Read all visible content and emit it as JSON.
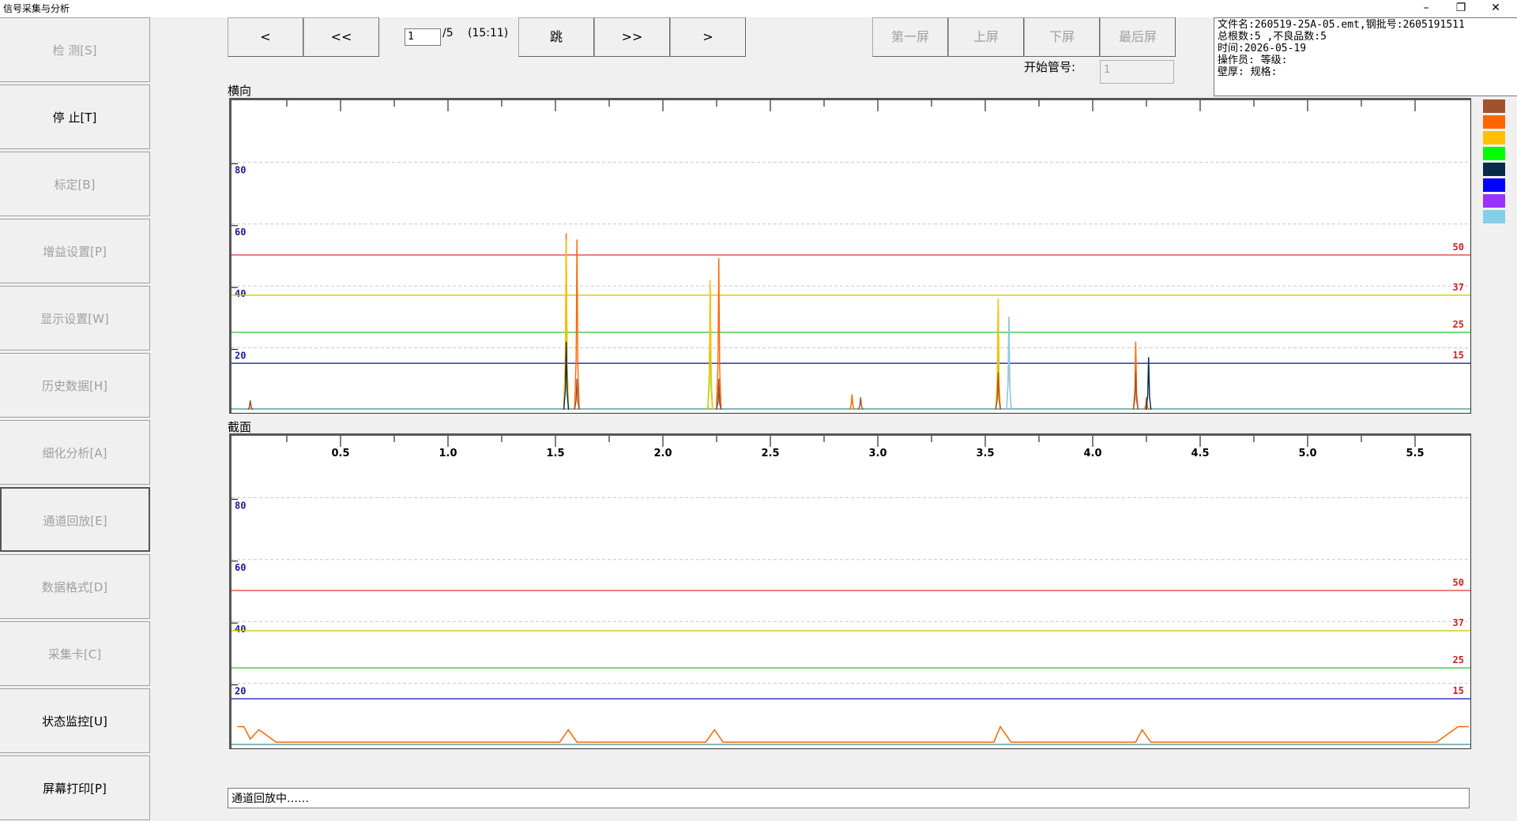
{
  "window": {
    "title": "信号采集与分析",
    "minimize": "–",
    "restore": "❐",
    "close": "✕"
  },
  "sidebar": {
    "items": [
      {
        "label": "检  测[S]",
        "enabled": false
      },
      {
        "label": "停 止[T]",
        "enabled": true
      },
      {
        "label": "标定[B]",
        "enabled": false
      },
      {
        "label": "增益设置[P]",
        "enabled": false
      },
      {
        "label": "显示设置[W]",
        "enabled": false
      },
      {
        "label": "历史数据[H]",
        "enabled": false
      },
      {
        "label": "细化分析[A]",
        "enabled": false
      },
      {
        "label": "通道回放[E]",
        "enabled": false
      },
      {
        "label": "数据格式[D]",
        "enabled": false
      },
      {
        "label": "采集卡[C]",
        "enabled": false
      },
      {
        "label": "状态监控[U]",
        "enabled": true
      },
      {
        "label": "屏幕打印[P]",
        "enabled": true
      }
    ]
  },
  "toolbar": {
    "prev": "<",
    "prev_fast": "<<",
    "page_value": "1",
    "page_total": "/5",
    "time": "(15:11)",
    "jump": "跳",
    "next_fast": ">>",
    "next": ">",
    "first_screen": "第一屏",
    "prev_screen": "上屏",
    "next_screen": "下屏",
    "last_screen": "最后屏",
    "start_tube_label": "开始管号:",
    "start_tube_value": "1"
  },
  "info": {
    "line1": "文件名:260519-25A-05.emt,钢批号:2605191511",
    "line2": "总根数:5 ,不良品数:5",
    "line3": "时间:2026-05-19",
    "line4": "操作员: 等级:",
    "line5": "壁厚:  规格:"
  },
  "legend_colors": [
    "#a0522d",
    "#ff6600",
    "#ffc000",
    "#00ff00",
    "#0a2a4a",
    "#0000ff",
    "#9b30ff",
    "#87ceeb"
  ],
  "sections": {
    "transverse": "横向",
    "section": "截面"
  },
  "status": "通道回放中……",
  "chart_data": [
    {
      "type": "line",
      "title": "横向",
      "ylim": [
        0,
        100
      ],
      "y_ticks": [
        20,
        40,
        60,
        80
      ],
      "x_ticks_labeled": false,
      "xlim": [
        0,
        5.75
      ],
      "thresholds": [
        {
          "value": 50,
          "color": "#e03030"
        },
        {
          "value": 37,
          "color": "#d4c800"
        },
        {
          "value": 25,
          "color": "#30c030"
        },
        {
          "value": 15,
          "color": "#2020c0"
        }
      ],
      "series": [
        {
          "color": "#ff6600",
          "points": [
            [
              0.08,
              3
            ],
            [
              1.55,
              57
            ],
            [
              1.6,
              55
            ],
            [
              2.22,
              40
            ],
            [
              2.26,
              49
            ],
            [
              2.88,
              5
            ],
            [
              3.56,
              35
            ],
            [
              3.61,
              30
            ],
            [
              4.2,
              22
            ],
            [
              4.25,
              4
            ]
          ]
        },
        {
          "color": "#00ff00",
          "points": [
            [
              1.55,
              52
            ],
            [
              2.22,
              30
            ],
            [
              3.56,
              25
            ]
          ]
        },
        {
          "color": "#ffc000",
          "points": [
            [
              1.55,
              55
            ],
            [
              2.22,
              42
            ],
            [
              3.56,
              36
            ]
          ]
        },
        {
          "color": "#87ceeb",
          "points": [
            [
              3.61,
              30
            ],
            [
              4.26,
              17
            ]
          ]
        },
        {
          "color": "#0a2a4a",
          "points": [
            [
              1.55,
              22
            ],
            [
              2.26,
              8
            ],
            [
              4.26,
              17
            ]
          ]
        },
        {
          "color": "#a0522d",
          "points": [
            [
              0.08,
              3
            ],
            [
              1.6,
              10
            ],
            [
              2.26,
              10
            ],
            [
              2.92,
              4
            ],
            [
              3.56,
              12
            ],
            [
              4.2,
              12
            ]
          ]
        }
      ]
    },
    {
      "type": "line",
      "title": "截面",
      "ylim": [
        0,
        100
      ],
      "y_ticks": [
        20,
        40,
        60,
        80
      ],
      "xlim": [
        0,
        5.75
      ],
      "x_ticks": [
        "0.5",
        "1.0",
        "1.5",
        "2.0",
        "2.5",
        "3.0",
        "3.5",
        "4.0",
        "4.5",
        "5.0",
        "5.5"
      ],
      "thresholds": [
        {
          "value": 50,
          "color": "#e03030"
        },
        {
          "value": 37,
          "color": "#d4c800"
        },
        {
          "value": 25,
          "color": "#30c030"
        },
        {
          "value": 15,
          "color": "#2020c0"
        }
      ],
      "series": [
        {
          "color": "#ff6600",
          "points": [
            [
              0.02,
              6
            ],
            [
              0.05,
              6
            ],
            [
              0.08,
              2
            ],
            [
              0.12,
              5
            ],
            [
              0.2,
              1
            ],
            [
              1.52,
              1
            ],
            [
              1.56,
              5
            ],
            [
              1.6,
              1
            ],
            [
              2.2,
              1
            ],
            [
              2.24,
              5
            ],
            [
              2.28,
              1
            ],
            [
              3.54,
              1
            ],
            [
              3.57,
              6
            ],
            [
              3.62,
              1
            ],
            [
              4.2,
              1
            ],
            [
              4.23,
              5
            ],
            [
              4.27,
              1
            ],
            [
              5.6,
              1
            ],
            [
              5.7,
              6
            ],
            [
              5.75,
              6
            ]
          ]
        }
      ]
    }
  ]
}
